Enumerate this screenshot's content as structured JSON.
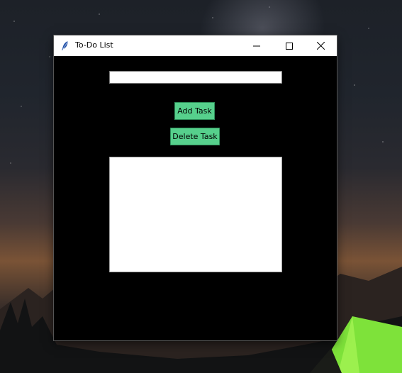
{
  "window": {
    "title": "To-Do List"
  },
  "titlebar": {
    "minimize_icon": "minimize-icon",
    "maximize_icon": "maximize-icon",
    "close_icon": "close-icon",
    "app_icon": "feather-icon"
  },
  "task_entry": {
    "value": "",
    "placeholder": ""
  },
  "buttons": {
    "add_label": "Add Task",
    "delete_label": "Delete Task"
  },
  "task_list": {
    "items": []
  },
  "colors": {
    "window_bg": "#000000",
    "button_bg": "#56d08c"
  }
}
